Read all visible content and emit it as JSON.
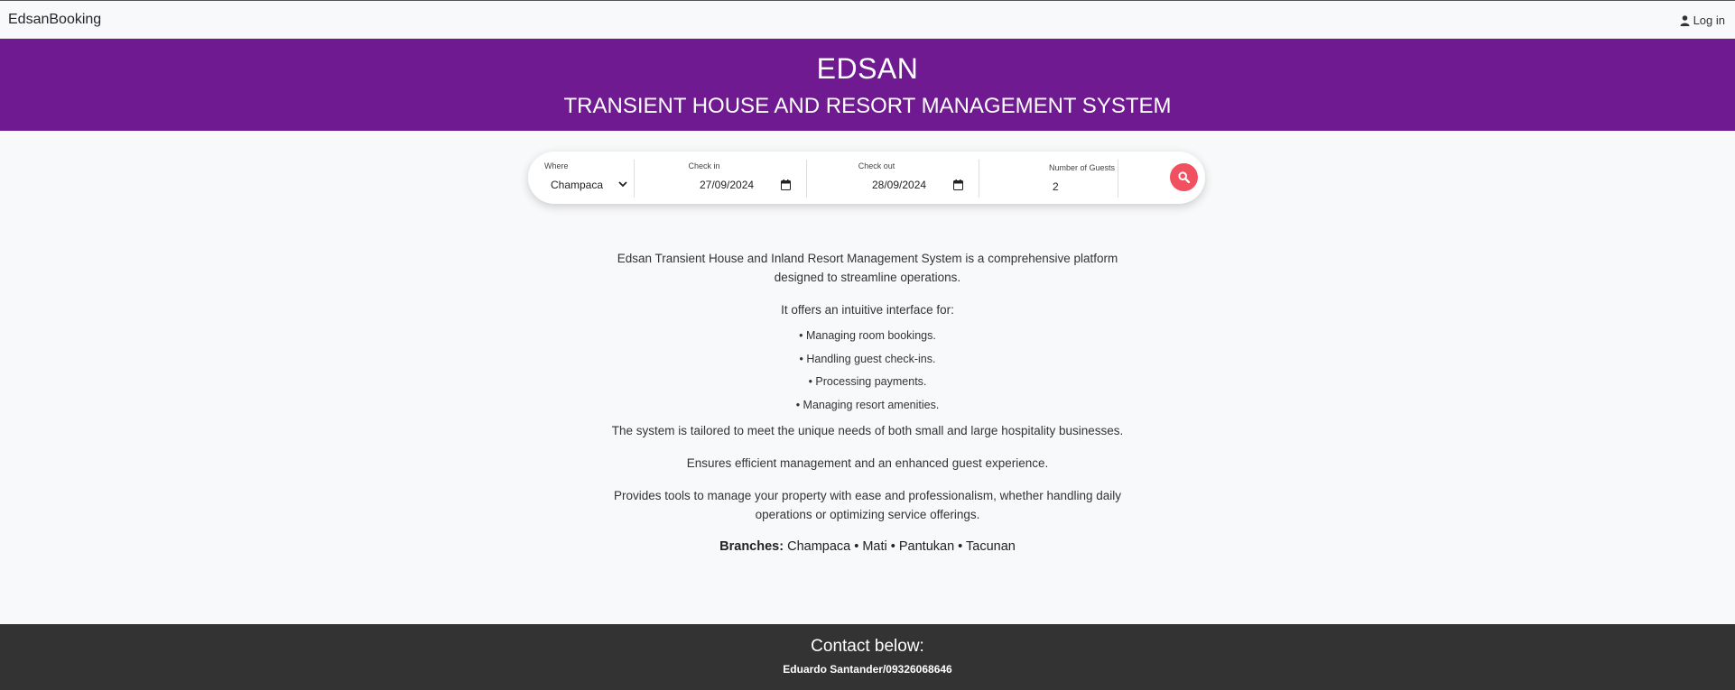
{
  "navbar": {
    "brand": "EdsanBooking",
    "login_label": "Log in"
  },
  "hero": {
    "title": "EDSAN",
    "subtitle": "TRANSIENT HOUSE AND RESORT MANAGEMENT SYSTEM",
    "bg_color": "#6f1a91"
  },
  "search": {
    "where_label": "Where",
    "where_value": "Champaca",
    "checkin_label": "Check in",
    "checkin_value": "27/09/2024",
    "checkout_label": "Check out",
    "checkout_value": "28/09/2024",
    "guests_label": "Number of Guests",
    "guests_value": "2",
    "button_color": "#f0505f"
  },
  "content": {
    "intro": "Edsan Transient House and Inland Resort Management System is a comprehensive platform designed to streamline operations.",
    "offers": "It offers an intuitive interface for:",
    "bullets": [
      "• Managing room bookings.",
      "• Handling guest check-ins.",
      "• Processing payments.",
      "• Managing resort amenities."
    ],
    "tailored": "The system is tailored to meet the unique needs of both small and large hospitality businesses.",
    "ensures": "Ensures efficient management and an enhanced guest experience.",
    "tools": "Provides tools to manage your property with ease and professionalism, whether handling daily operations or optimizing service offerings.",
    "branches_label": "Branches:",
    "branches_value": "Champaca • Mati • Pantukan • Tacunan"
  },
  "footer": {
    "title": "Contact below:",
    "contact": "Eduardo Santander/09326068646"
  }
}
